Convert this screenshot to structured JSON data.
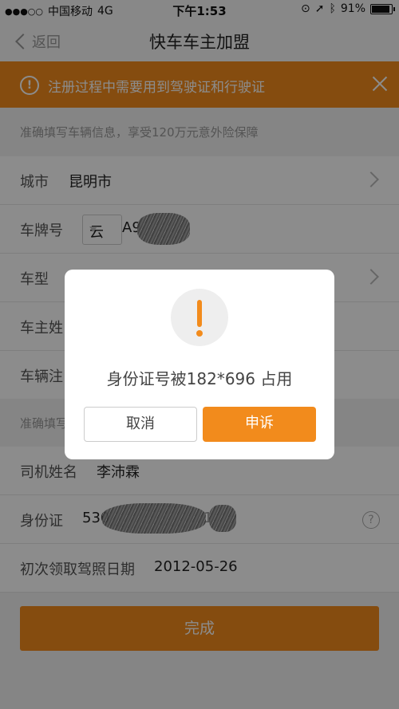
{
  "status_bar": {
    "carrier": "中国移动",
    "network": "4G",
    "time": "下午1:53",
    "battery": "91%",
    "battery_level": 0.91
  },
  "nav": {
    "back_label": "返回",
    "title": "快车车主加盟"
  },
  "notice": {
    "text": "注册过程中需要用到驾驶证和行驶证"
  },
  "vehicle_section": {
    "hint": "准确填写车辆信息，享受120万元意外险保障",
    "rows": {
      "city_label": "城市",
      "city_value": "昆明市",
      "plate_label": "车牌号",
      "plate_province": "云",
      "plate_prefix": "A9",
      "model_label": "车型",
      "owner_label": "车主姓",
      "reg_label": "车辆注"
    }
  },
  "driver_section": {
    "hint": "准确填写",
    "rows": {
      "name_label": "司机姓名",
      "name_value": "李沛霖",
      "id_label": "身份证",
      "id_prefix": "530",
      "id_tail_fragment": "1",
      "license_date_label": "初次领取驾照日期",
      "license_date_value": "2012-05-26"
    }
  },
  "done_label": "完成",
  "dialog": {
    "message": "身份证号被182*696 占用",
    "cancel_label": "取消",
    "appeal_label": "申诉"
  },
  "colors": {
    "accent": "#f28b1c"
  }
}
